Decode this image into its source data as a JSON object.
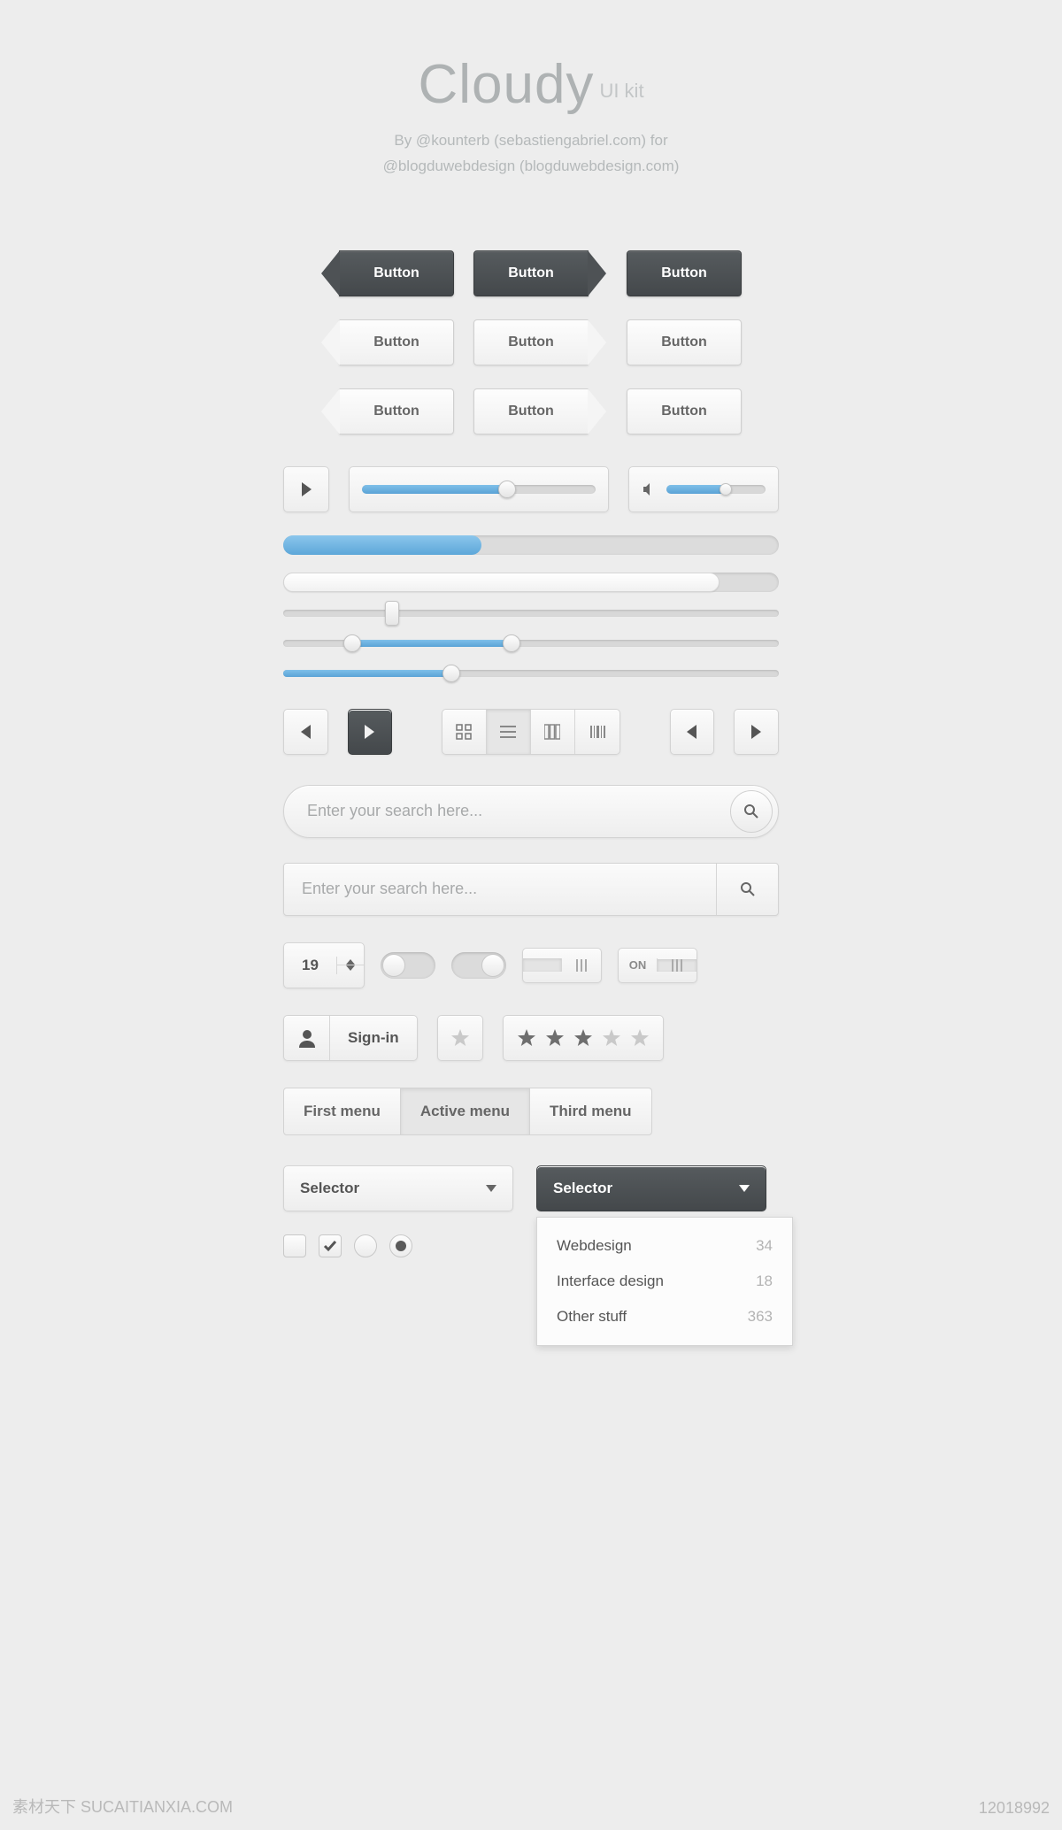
{
  "header": {
    "title": "Cloudy",
    "subtitle": "UI kit",
    "credit_line1": "By @kounterb (sebastiengabriel.com) for",
    "credit_line2": "@blogduwebdesign (blogduwebdesign.com)"
  },
  "colors": {
    "accent": "#66aedd",
    "dark": "#4c5053"
  },
  "buttons": {
    "row1": [
      "Button",
      "Button",
      "Button"
    ],
    "row2": [
      "Button",
      "Button",
      "Button"
    ],
    "row3": [
      "Button",
      "Button",
      "Button"
    ]
  },
  "player": {
    "progress_pct": 62,
    "volume_pct": 60
  },
  "progress": {
    "blue_pct": 40,
    "white_pct": 88
  },
  "sliders": {
    "single_knob_pct": 22,
    "range_start_pct": 14,
    "range_end_pct": 46,
    "blue_value_pct": 34
  },
  "view_icons": [
    "grid-icon",
    "list-icon",
    "columns-icon",
    "barcode-icon"
  ],
  "search": {
    "placeholder_round": "Enter your search here...",
    "placeholder_rect": "Enter your search here..."
  },
  "stepper": {
    "value": "19"
  },
  "switch_on_label": "ON",
  "signin": {
    "label": "Sign-in"
  },
  "rating": {
    "value": 3,
    "max": 5
  },
  "tabs": [
    "First menu",
    "Active menu",
    "Third menu"
  ],
  "tabs_active_index": 1,
  "selects": {
    "light_label": "Selector",
    "dark_label": "Selector"
  },
  "dropdown": [
    {
      "label": "Webdesign",
      "count": "34"
    },
    {
      "label": "Interface design",
      "count": "18"
    },
    {
      "label": "Other stuff",
      "count": "363"
    }
  ],
  "footer": {
    "watermark": "素材天下 SUCAITIANXIA.COM",
    "asset_id": "12018992"
  }
}
